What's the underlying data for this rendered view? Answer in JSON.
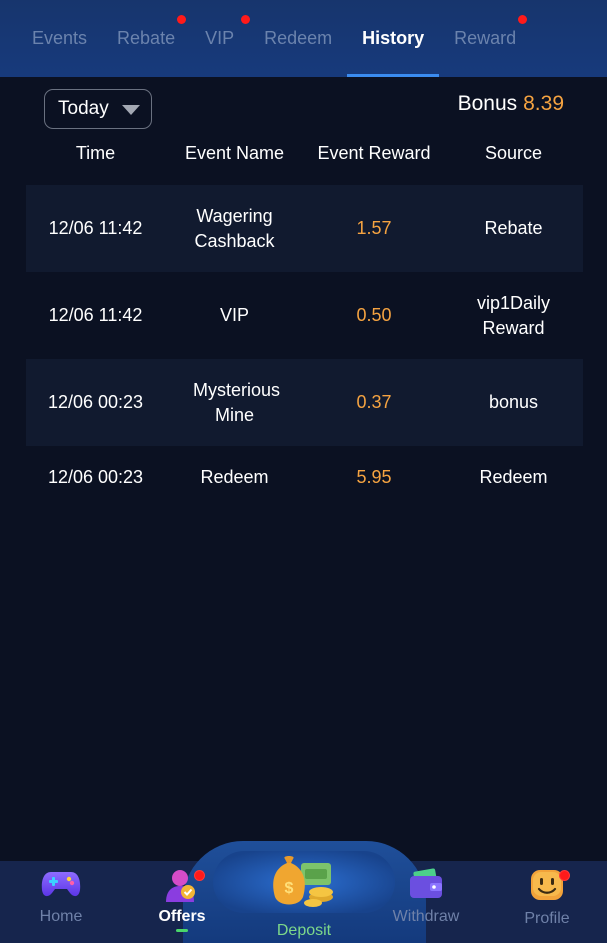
{
  "tabs": [
    {
      "label": "Events",
      "active": false,
      "dot": false
    },
    {
      "label": "Rebate",
      "active": false,
      "dot": true
    },
    {
      "label": "VIP",
      "active": false,
      "dot": true
    },
    {
      "label": "Redeem",
      "active": false,
      "dot": false
    },
    {
      "label": "History",
      "active": true,
      "dot": false
    },
    {
      "label": "Reward",
      "active": false,
      "dot": true
    }
  ],
  "filter": {
    "selected": "Today"
  },
  "bonus": {
    "label": "Bonus",
    "value": "8.39"
  },
  "table": {
    "headers": [
      "Time",
      "Event Name",
      "Event Reward",
      "Source"
    ],
    "rows": [
      {
        "time": "12/06 11:42",
        "event": "Wagering Cashback",
        "reward": "1.57",
        "source": "Rebate"
      },
      {
        "time": "12/06 11:42",
        "event": "VIP",
        "reward": "0.50",
        "source": "vip1Daily Reward"
      },
      {
        "time": "12/06 00:23",
        "event": "Mysterious Mine",
        "reward": "0.37",
        "source": "bonus"
      },
      {
        "time": "12/06 00:23",
        "event": "Redeem",
        "reward": "5.95",
        "source": "Redeem"
      }
    ]
  },
  "nav": {
    "home": "Home",
    "offers": "Offers",
    "deposit": "Deposit",
    "withdraw": "Withdraw",
    "profile": "Profile"
  },
  "colors": {
    "accent_orange": "#f5a341",
    "active_tab_underline": "#3b8cf0",
    "notification_dot": "#ff1a1a",
    "deposit_green": "#7dd88a"
  }
}
